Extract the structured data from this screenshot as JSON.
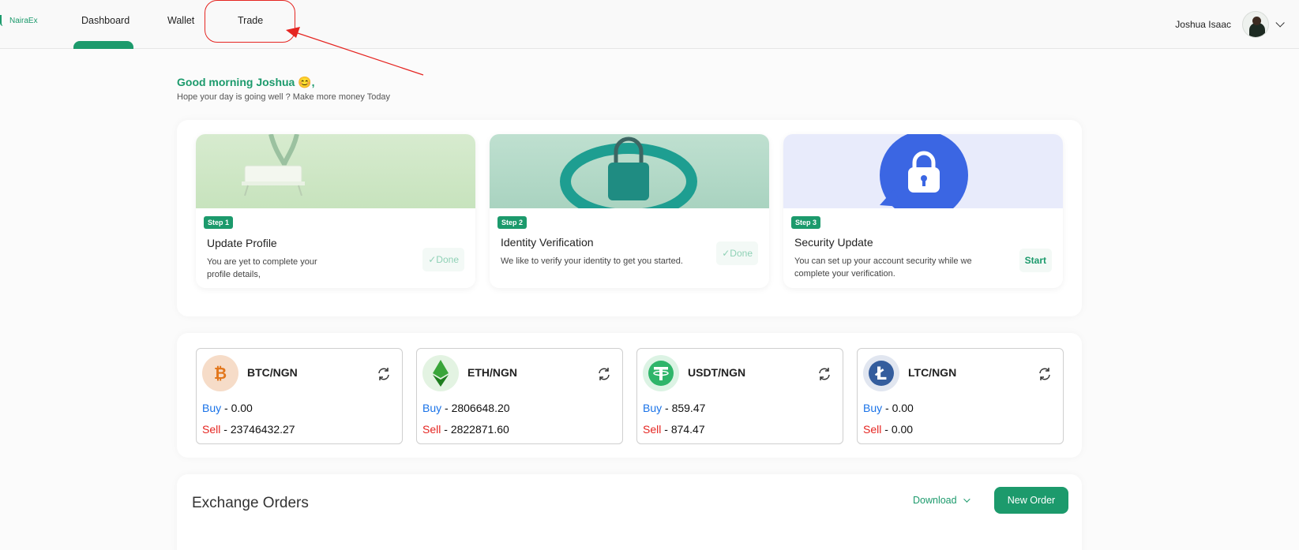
{
  "brand": {
    "name": "NairaEx"
  },
  "nav": {
    "items": [
      {
        "label": "Dashboard"
      },
      {
        "label": "Wallet"
      },
      {
        "label": "Trade"
      }
    ],
    "active": "Dashboard",
    "highlighted": "Trade"
  },
  "user": {
    "name": "Joshua Isaac"
  },
  "greeting": {
    "title": "Good morning Joshua 😊,",
    "subtitle": "Hope your day is going well ? Make more money Today"
  },
  "steps": [
    {
      "badge": "Step 1",
      "title": "Update Profile",
      "desc_line1": "You are yet to complete your",
      "desc_line2": "profile details,",
      "action": "✓Done",
      "status": "done"
    },
    {
      "badge": "Step 2",
      "title": "Identity Verification",
      "desc_line1": "We like to verify your identity to get you started.",
      "desc_line2": "",
      "action": "✓Done",
      "status": "done"
    },
    {
      "badge": "Step 3",
      "title": "Security Update",
      "desc_line1": "You can set up your account security while we",
      "desc_line2": "complete your verification.",
      "action": "Start",
      "status": "pending"
    }
  ],
  "rates": [
    {
      "pair": "BTC/NGN",
      "buy_label": "Buy",
      "buy": "0.00",
      "sell_label": "Sell",
      "sell": "23746432.27",
      "icon": "bitcoin-icon"
    },
    {
      "pair": "ETH/NGN",
      "buy_label": "Buy",
      "buy": "2806648.20",
      "sell_label": "Sell",
      "sell": "2822871.60",
      "icon": "ethereum-icon"
    },
    {
      "pair": "USDT/NGN",
      "buy_label": "Buy",
      "buy": "859.47",
      "sell_label": "Sell",
      "sell": "874.47",
      "icon": "tether-icon"
    },
    {
      "pair": "LTC/NGN",
      "buy_label": "Buy",
      "buy": "0.00",
      "sell_label": "Sell",
      "sell": "0.00",
      "icon": "litecoin-icon"
    }
  ],
  "orders": {
    "title": "Exchange Orders",
    "download_label": "Download",
    "new_order_label": "New Order"
  },
  "colors": {
    "accent": "#1c9a6c",
    "buy": "#1a73e8",
    "sell": "#e52521",
    "annotation": "#e52521"
  }
}
